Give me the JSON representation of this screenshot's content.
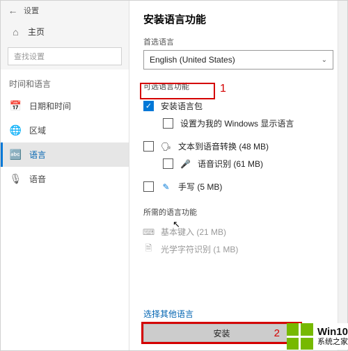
{
  "titlebar": {
    "label": "设置"
  },
  "home": {
    "label": "主页"
  },
  "search": {
    "placeholder": "查找设置"
  },
  "section": {
    "label": "时间和语言"
  },
  "nav": {
    "items": [
      {
        "icon": "calendar-icon",
        "glyph": "📅",
        "label": "日期和时间"
      },
      {
        "icon": "globe-icon",
        "glyph": "🌐",
        "label": "区域"
      },
      {
        "icon": "language-icon",
        "glyph": "🔤",
        "label": "语言",
        "active": true
      },
      {
        "icon": "mic-icon",
        "glyph": "🎙",
        "label": "语音"
      }
    ]
  },
  "dialog": {
    "title": "安装语言功能",
    "preferred_label": "首选语言",
    "language_value": "English (United States)",
    "options_label": "可选语言功能",
    "opts": {
      "install_pack": "安装语言包",
      "set_display": "设置为我的 Windows 显示语言",
      "tts": "文本到语音转换 (48 MB)",
      "speech": "语音识别 (61 MB)",
      "handwriting": "手写 (5 MB)"
    },
    "required_label": "所需的语言功能",
    "req": {
      "basic_typing": "基本键入 (21 MB)",
      "ocr": "光学字符识别 (1 MB)"
    },
    "link": "选择其他语言",
    "install_btn": "安装"
  },
  "annotations": {
    "one": "1",
    "two": "2"
  },
  "watermark": {
    "line1": "Win10",
    "line2": "系统之家"
  }
}
